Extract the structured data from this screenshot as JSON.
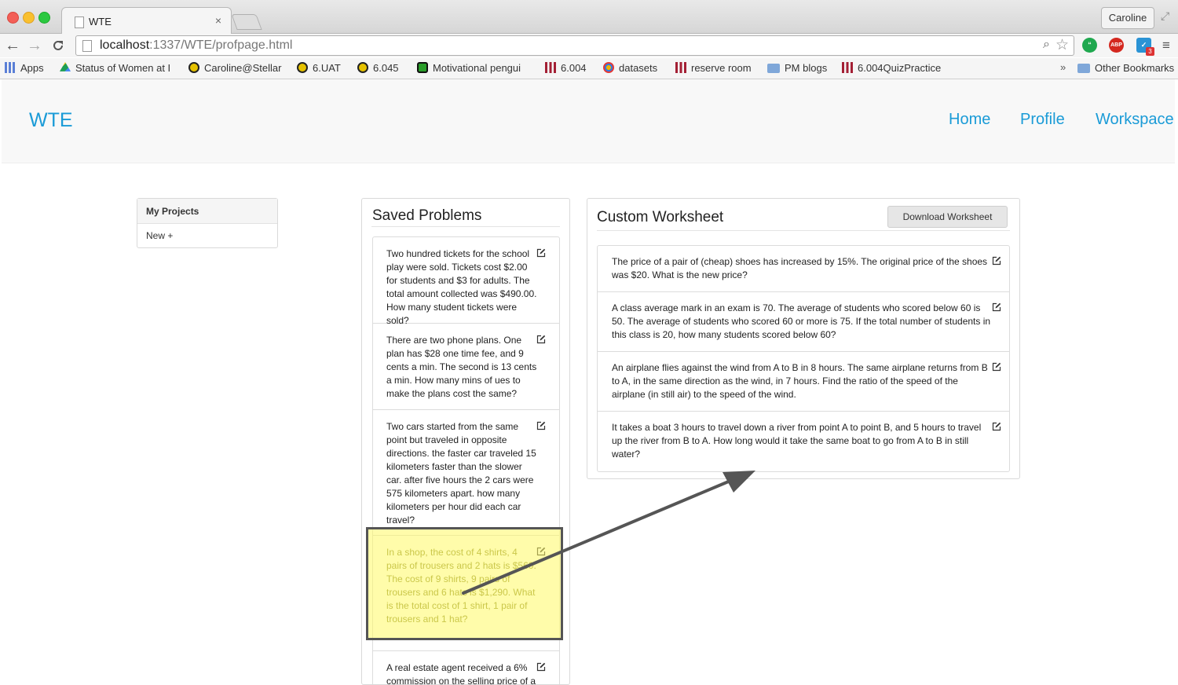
{
  "browser": {
    "tab_title": "WTE",
    "tab_close": "×",
    "profile_name": "Caroline",
    "url_host": "localhost",
    "url_path": ":1337/WTE/profpage.html",
    "nav_back": "←",
    "nav_forward": "→",
    "nav_reload": "C",
    "zoom_glyph": "⌕",
    "star_glyph": "☆",
    "ext_abp": "ABP",
    "ext_badge": "3",
    "menu_glyph": "≡",
    "resize_glyph": "⤢",
    "bookmarks": [
      {
        "label": "Apps",
        "icon": "apps-grid-icon"
      },
      {
        "label": "Status of Women at I",
        "icon": "google-drive-icon"
      },
      {
        "label": "Caroline@Stellar",
        "icon": "stellar-icon"
      },
      {
        "label": "6.UAT",
        "icon": "stellar-icon"
      },
      {
        "label": "6.045",
        "icon": "stellar-icon"
      },
      {
        "label": "Motivational pengui",
        "icon": "green-square-icon"
      },
      {
        "label": "6.004",
        "icon": "mit-logo-icon"
      },
      {
        "label": "datasets",
        "icon": "pinwheel-icon"
      },
      {
        "label": "reserve room",
        "icon": "mit-logo-icon"
      },
      {
        "label": "PM blogs",
        "icon": "folder-icon"
      },
      {
        "label": "6.004QuizPractice",
        "icon": "mit-logo-icon"
      }
    ],
    "bookmarks_more": "»",
    "other_bookmarks": "Other Bookmarks"
  },
  "site": {
    "brand": "WTE",
    "nav": [
      "Home",
      "Profile",
      "Workspace"
    ],
    "link_color": "#1a9bd7"
  },
  "projects": {
    "title": "My Projects",
    "new_label": "New +"
  },
  "saved": {
    "title": "Saved Problems",
    "problems": [
      "Two hundred tickets for the school play were sold. Tickets cost $2.00 for students and $3 for adults. The total amount collected was $490.00. How many student tickets were sold?",
      "There are two phone plans. One plan has $28 one time fee, and 9 cents a min. The second is 13 cents a min. How many mins of ues to make the plans cost the same?",
      "Two cars started from the same point but traveled in opposite directions. the faster car traveled 15 kilometers faster than the slower car. after five hours the 2 cars were 575 kilometers apart. how many kilometers per hour did each car travel?",
      "In a shop, the cost of 4 shirts, 4 pairs of trousers and 2 hats is $560. The cost of 9 shirts, 9 pairs of trousers and 6 hats is $1,290. What is the total cost of 1 shirt, 1 pair of trousers and 1 hat?",
      "A real estate agent received a 6% commission on the selling price of a"
    ]
  },
  "worksheet": {
    "title": "Custom Worksheet",
    "download_label": "Download Worksheet",
    "problems": [
      "The price of a pair of (cheap) shoes has increased by 15%. The original price of the shoes was $20. What is the new price?",
      "A class average mark in an exam is 70. The average of students who scored below 60 is 50. The average of students who scored 60 or more is 75. If the total number of students in this class is 20, how many students scored below 60?",
      "An airplane flies against the wind from A to B in 8 hours. The same airplane returns from B to A, in the same direction as the wind, in 7 hours. Find the ratio of the speed of the airplane (in still air) to the speed of the wind.",
      "It takes a boat 3 hours to travel down a river from point A to point B, and 5 hours to travel up the river from B to A. How long would it take the same boat to go from A to B in still water?"
    ]
  },
  "annotation": {
    "highlight_color": "#fffa64",
    "arrow_color": "#555555"
  }
}
